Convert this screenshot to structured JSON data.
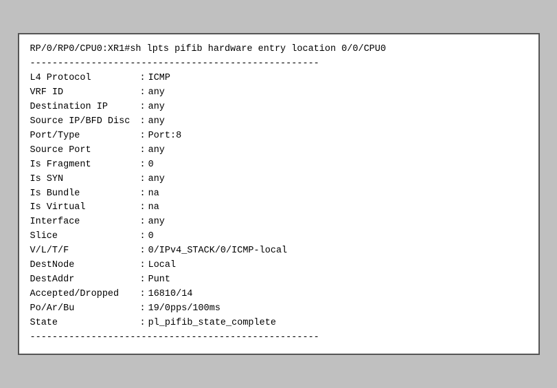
{
  "terminal": {
    "prompt_line": "RP/0/RP0/CPU0:XR1#sh lpts pifib hardware entry location 0/0/CPU0",
    "divider": "----------------------------------------------------",
    "fields": [
      {
        "label": "L4 Protocol",
        "value": "ICMP"
      },
      {
        "label": "VRF ID",
        "value": "any"
      },
      {
        "label": "Destination IP",
        "value": "any"
      },
      {
        "label": "Source IP/BFD Disc",
        "value": "any"
      },
      {
        "label": "Port/Type",
        "value": "Port:8"
      },
      {
        "label": "Source Port",
        "value": "any"
      },
      {
        "label": "Is Fragment",
        "value": "0"
      },
      {
        "label": "Is SYN",
        "value": "any"
      },
      {
        "label": "Is Bundle",
        "value": "na"
      },
      {
        "label": "Is Virtual",
        "value": "na"
      },
      {
        "label": "Interface",
        "value": "any"
      },
      {
        "label": "Slice",
        "value": "0"
      },
      {
        "label": "V/L/T/F",
        "value": "0/IPv4_STACK/0/ICMP-local"
      },
      {
        "label": "DestNode",
        "value": "Local"
      },
      {
        "label": "DestAddr",
        "value": "Punt"
      },
      {
        "label": "Accepted/Dropped",
        "value": "16810/14"
      },
      {
        "label": "Po/Ar/Bu",
        "value": "19/0pps/100ms"
      },
      {
        "label": "State",
        "value": "pl_pifib_state_complete"
      }
    ]
  }
}
